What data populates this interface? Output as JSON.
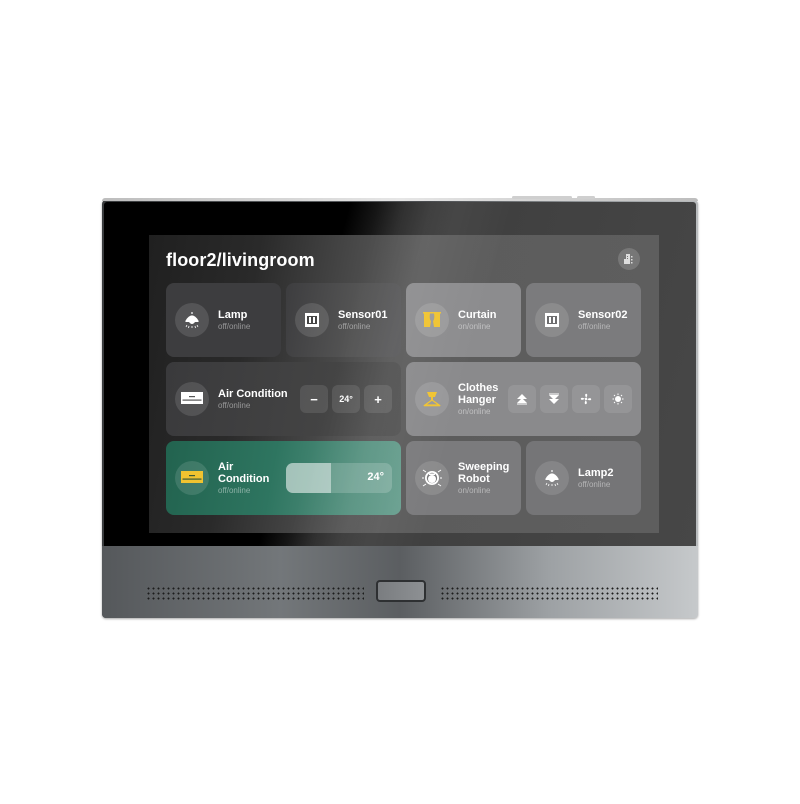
{
  "header": {
    "title": "floor2/livingroom",
    "building_icon": "building-icon"
  },
  "devices": [
    {
      "name": "Lamp",
      "status": "off/online",
      "icon": "lamp-icon"
    },
    {
      "name": "Sensor01",
      "status": "off/online",
      "icon": "sensor-panel-icon"
    },
    {
      "name": "Curtain",
      "status": "on/online",
      "icon": "curtain-icon"
    },
    {
      "name": "Sensor02",
      "status": "off/online",
      "icon": "sensor-panel-icon"
    },
    {
      "name": "Air Condition",
      "status": "off/online",
      "icon": "air-conditioner-icon",
      "controls": {
        "decrease": "−",
        "temperature": "24°",
        "increase": "+"
      }
    },
    {
      "name": "Clothes Hanger",
      "name_line1": "Clothes",
      "name_line2": "Hanger",
      "status": "on/online",
      "icon": "clothes-hanger-icon",
      "controls": [
        "raise-icon",
        "lower-icon",
        "fan-dry-icon",
        "sun-light-icon"
      ]
    },
    {
      "name": "Air Condition",
      "name_line1": "Air",
      "name_line2": "Condition",
      "status": "off/online",
      "icon": "air-conditioner-icon",
      "slider": {
        "value_label": "24°",
        "fill_fraction": 0.42
      }
    },
    {
      "name": "Sweeping Robot",
      "name_line1": "Sweeping",
      "name_line2": "Robot",
      "status": "on/online",
      "icon": "robot-vacuum-icon"
    },
    {
      "name": "Lamp2",
      "status": "off/online",
      "icon": "lamp-icon"
    }
  ],
  "colors": {
    "accent_yellow": "#f0c330",
    "active_card_green": "#2e7560",
    "text_primary": "#ffffff"
  }
}
